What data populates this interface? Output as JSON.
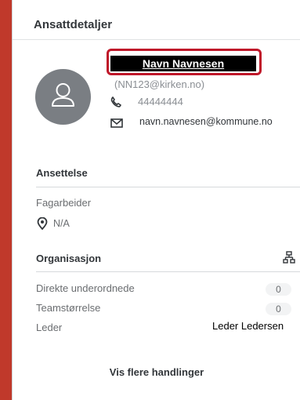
{
  "header": {
    "title": "Ansattdetaljer"
  },
  "profile": {
    "name": "Navn Navnesen",
    "user_id": "(NN123@kirken.no)",
    "phone": "44444444",
    "email": "navn.navnesen@kommune.no"
  },
  "employment": {
    "title": "Ansettelse",
    "job_title": "Fagarbeider",
    "location": "N/A"
  },
  "organization": {
    "title": "Organisasjon",
    "direct_reports_label": "Direkte underordnede",
    "direct_reports_count": "0",
    "team_size_label": "Teamstørrelse",
    "team_size_count": "0",
    "leader_label": "Leder",
    "leader_name": "Leder Ledersen"
  },
  "actions": {
    "more_label": "Vis flere handlinger"
  },
  "colors": {
    "highlight_border": "#c0182a",
    "left_bar": "#c0392b",
    "avatar_bg": "#7a7e83"
  }
}
